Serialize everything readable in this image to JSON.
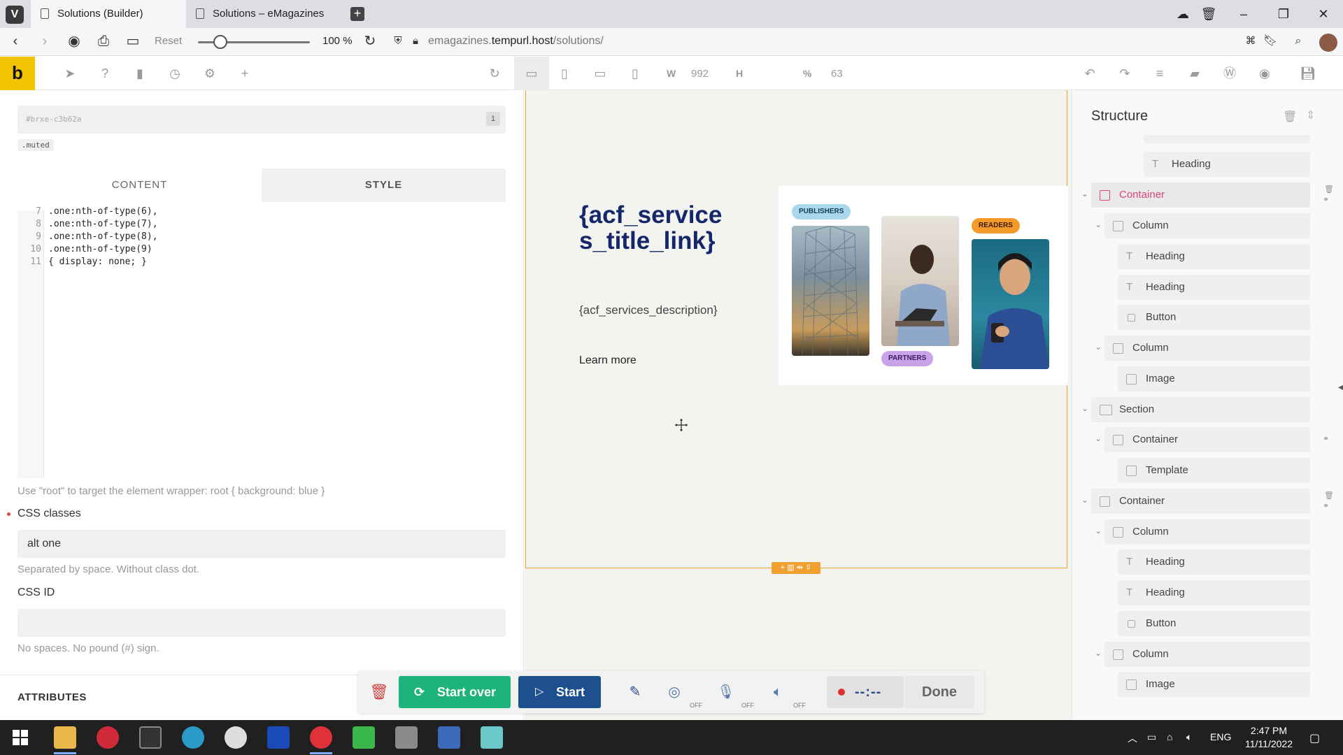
{
  "browser": {
    "tabs": [
      {
        "title": "Solutions (Builder)",
        "active": true
      },
      {
        "title": "Solutions – eMagazines",
        "active": false
      }
    ],
    "reset_label": "Reset",
    "zoom": "100 %",
    "url_prefix": "emagazines.",
    "url_domain": "tempurl.host",
    "url_path": "/solutions/"
  },
  "builder_toolbar": {
    "logo": "b",
    "width_label": "W",
    "width_value": "992",
    "height_label": "H",
    "percent_label": "%",
    "percent_value": "63"
  },
  "left_panel": {
    "element_id": "#brxe-c3b62a",
    "id_count": "1",
    "class_chip": ".muted",
    "tabs": {
      "content": "CONTENT",
      "style": "STYLE"
    },
    "code_lines": [
      {
        "num": "7",
        "text": ".one:nth-of-type(6),"
      },
      {
        "num": "8",
        "text": ".one:nth-of-type(7),"
      },
      {
        "num": "9",
        "text": ".one:nth-of-type(8),"
      },
      {
        "num": "10",
        "text": ".one:nth-of-type(9)"
      },
      {
        "num": "11",
        "text": "{ display: none; }"
      }
    ],
    "root_hint": "Use \"root\" to target the element wrapper: root { background: blue }",
    "css_classes_label": "CSS classes",
    "css_classes_value": "alt one",
    "css_classes_hint": "Separated by space. Without class dot.",
    "css_id_label": "CSS ID",
    "css_id_value": "",
    "css_id_hint": "No spaces. No pound (#) sign.",
    "attributes_label": "ATTRIBUTES"
  },
  "canvas": {
    "title": "{acf_services_title_link}",
    "description": "{acf_services_description}",
    "link": "Learn more",
    "pills": {
      "publishers": "PUBLISHERS",
      "partners": "PARTNERS",
      "readers": "READERS"
    },
    "section_handles": "+ ▥ ⇹ ⇳"
  },
  "structure": {
    "title": "Structure",
    "items": [
      {
        "label": "Heading",
        "type": "heading"
      },
      {
        "label": "Container",
        "type": "container"
      },
      {
        "label": "Column",
        "type": "column"
      },
      {
        "label": "Heading",
        "type": "heading"
      },
      {
        "label": "Heading",
        "type": "heading"
      },
      {
        "label": "Button",
        "type": "button"
      },
      {
        "label": "Column",
        "type": "column"
      },
      {
        "label": "Image",
        "type": "image"
      },
      {
        "label": "Section",
        "type": "section"
      },
      {
        "label": "Container",
        "type": "container"
      },
      {
        "label": "Template",
        "type": "template"
      },
      {
        "label": "Container",
        "type": "container"
      },
      {
        "label": "Column",
        "type": "column"
      },
      {
        "label": "Heading",
        "type": "heading"
      },
      {
        "label": "Heading",
        "type": "heading"
      },
      {
        "label": "Button",
        "type": "button"
      },
      {
        "label": "Column",
        "type": "column"
      },
      {
        "label": "Image",
        "type": "image"
      }
    ]
  },
  "recorder": {
    "start_over": "Start over",
    "start": "Start",
    "off1": "OFF",
    "off2": "OFF",
    "off3": "OFF",
    "timer": "--:--",
    "done": "Done"
  },
  "taskbar": {
    "lang": "ENG",
    "time": "2:47 PM",
    "date": "11/11/2022"
  },
  "colors": {
    "accent_yellow": "#f5c400",
    "selection_pink": "#e0447a",
    "heading_navy": "#15266a",
    "start_over_green": "#1db37a",
    "start_blue": "#1e4f8f",
    "section_outline": "#f0a030"
  }
}
